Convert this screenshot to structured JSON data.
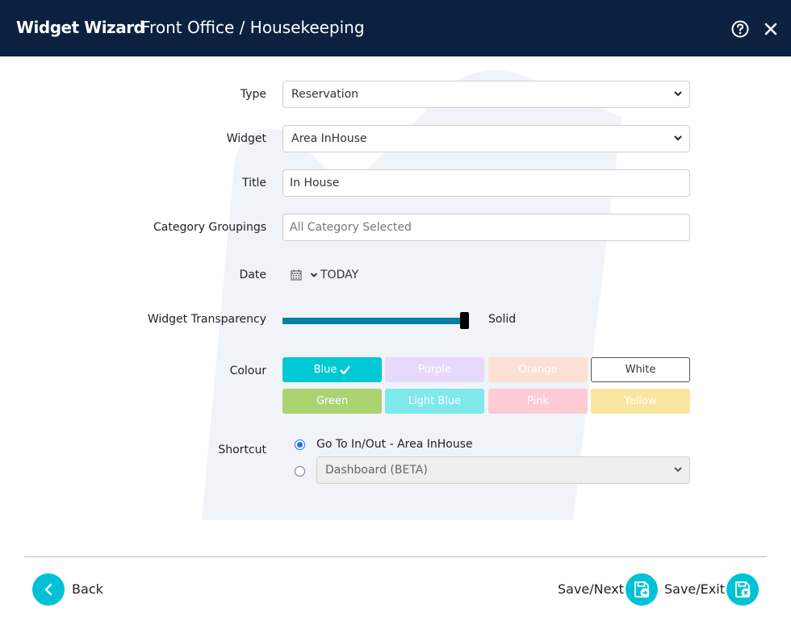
{
  "header": {
    "title": "Widget Wizard",
    "subtitle": "Front Office / Housekeeping",
    "help_icon": "question-circle-icon",
    "close_icon": "close-icon"
  },
  "form": {
    "type": {
      "label": "Type",
      "value": "Reservation"
    },
    "widget": {
      "label": "Widget",
      "value": "Area InHouse"
    },
    "title": {
      "label": "Title",
      "value": "In House"
    },
    "category": {
      "label": "Category Groupings",
      "placeholder": "All Category Selected"
    },
    "date": {
      "label": "Date",
      "value": "TODAY",
      "icon": "calendar-icon"
    },
    "transparency": {
      "label": "Widget Transparency",
      "value_label": "Solid",
      "level_fraction": 1.0
    },
    "colour": {
      "label": "Colour",
      "options": [
        {
          "label": "Blue",
          "color": "#00c8d4",
          "text_color": "#ffffff",
          "selected": true
        },
        {
          "label": "Purple",
          "color": "#e6d9fb",
          "text_color": "#ffffff",
          "selected": false
        },
        {
          "label": "Orange",
          "color": "#fde0d4",
          "text_color": "#ffffff",
          "selected": false
        },
        {
          "label": "White",
          "color": "#ffffff",
          "text_color": "#333333",
          "selected": false
        },
        {
          "label": "Green",
          "color": "#abd372",
          "text_color": "#ffffff",
          "selected": false
        },
        {
          "label": "Light Blue",
          "color": "#7fe8ea",
          "text_color": "#ffffff",
          "selected": false
        },
        {
          "label": "Pink",
          "color": "#ffcbd4",
          "text_color": "#ffffff",
          "selected": false
        },
        {
          "label": "Yellow",
          "color": "#f9e5a0",
          "text_color": "#ffffff",
          "selected": false
        }
      ]
    },
    "shortcut": {
      "label": "Shortcut",
      "option1": "Go To In/Out - Area InHouse",
      "option2_select": "Dashboard (BETA)"
    }
  },
  "footer": {
    "back": "Back",
    "save_next": "Save/Next",
    "save_exit": "Save/Exit"
  },
  "colors": {
    "header_bg": "#0c2140",
    "accent": "#00c2d6",
    "slider": "#0a7fa6"
  }
}
